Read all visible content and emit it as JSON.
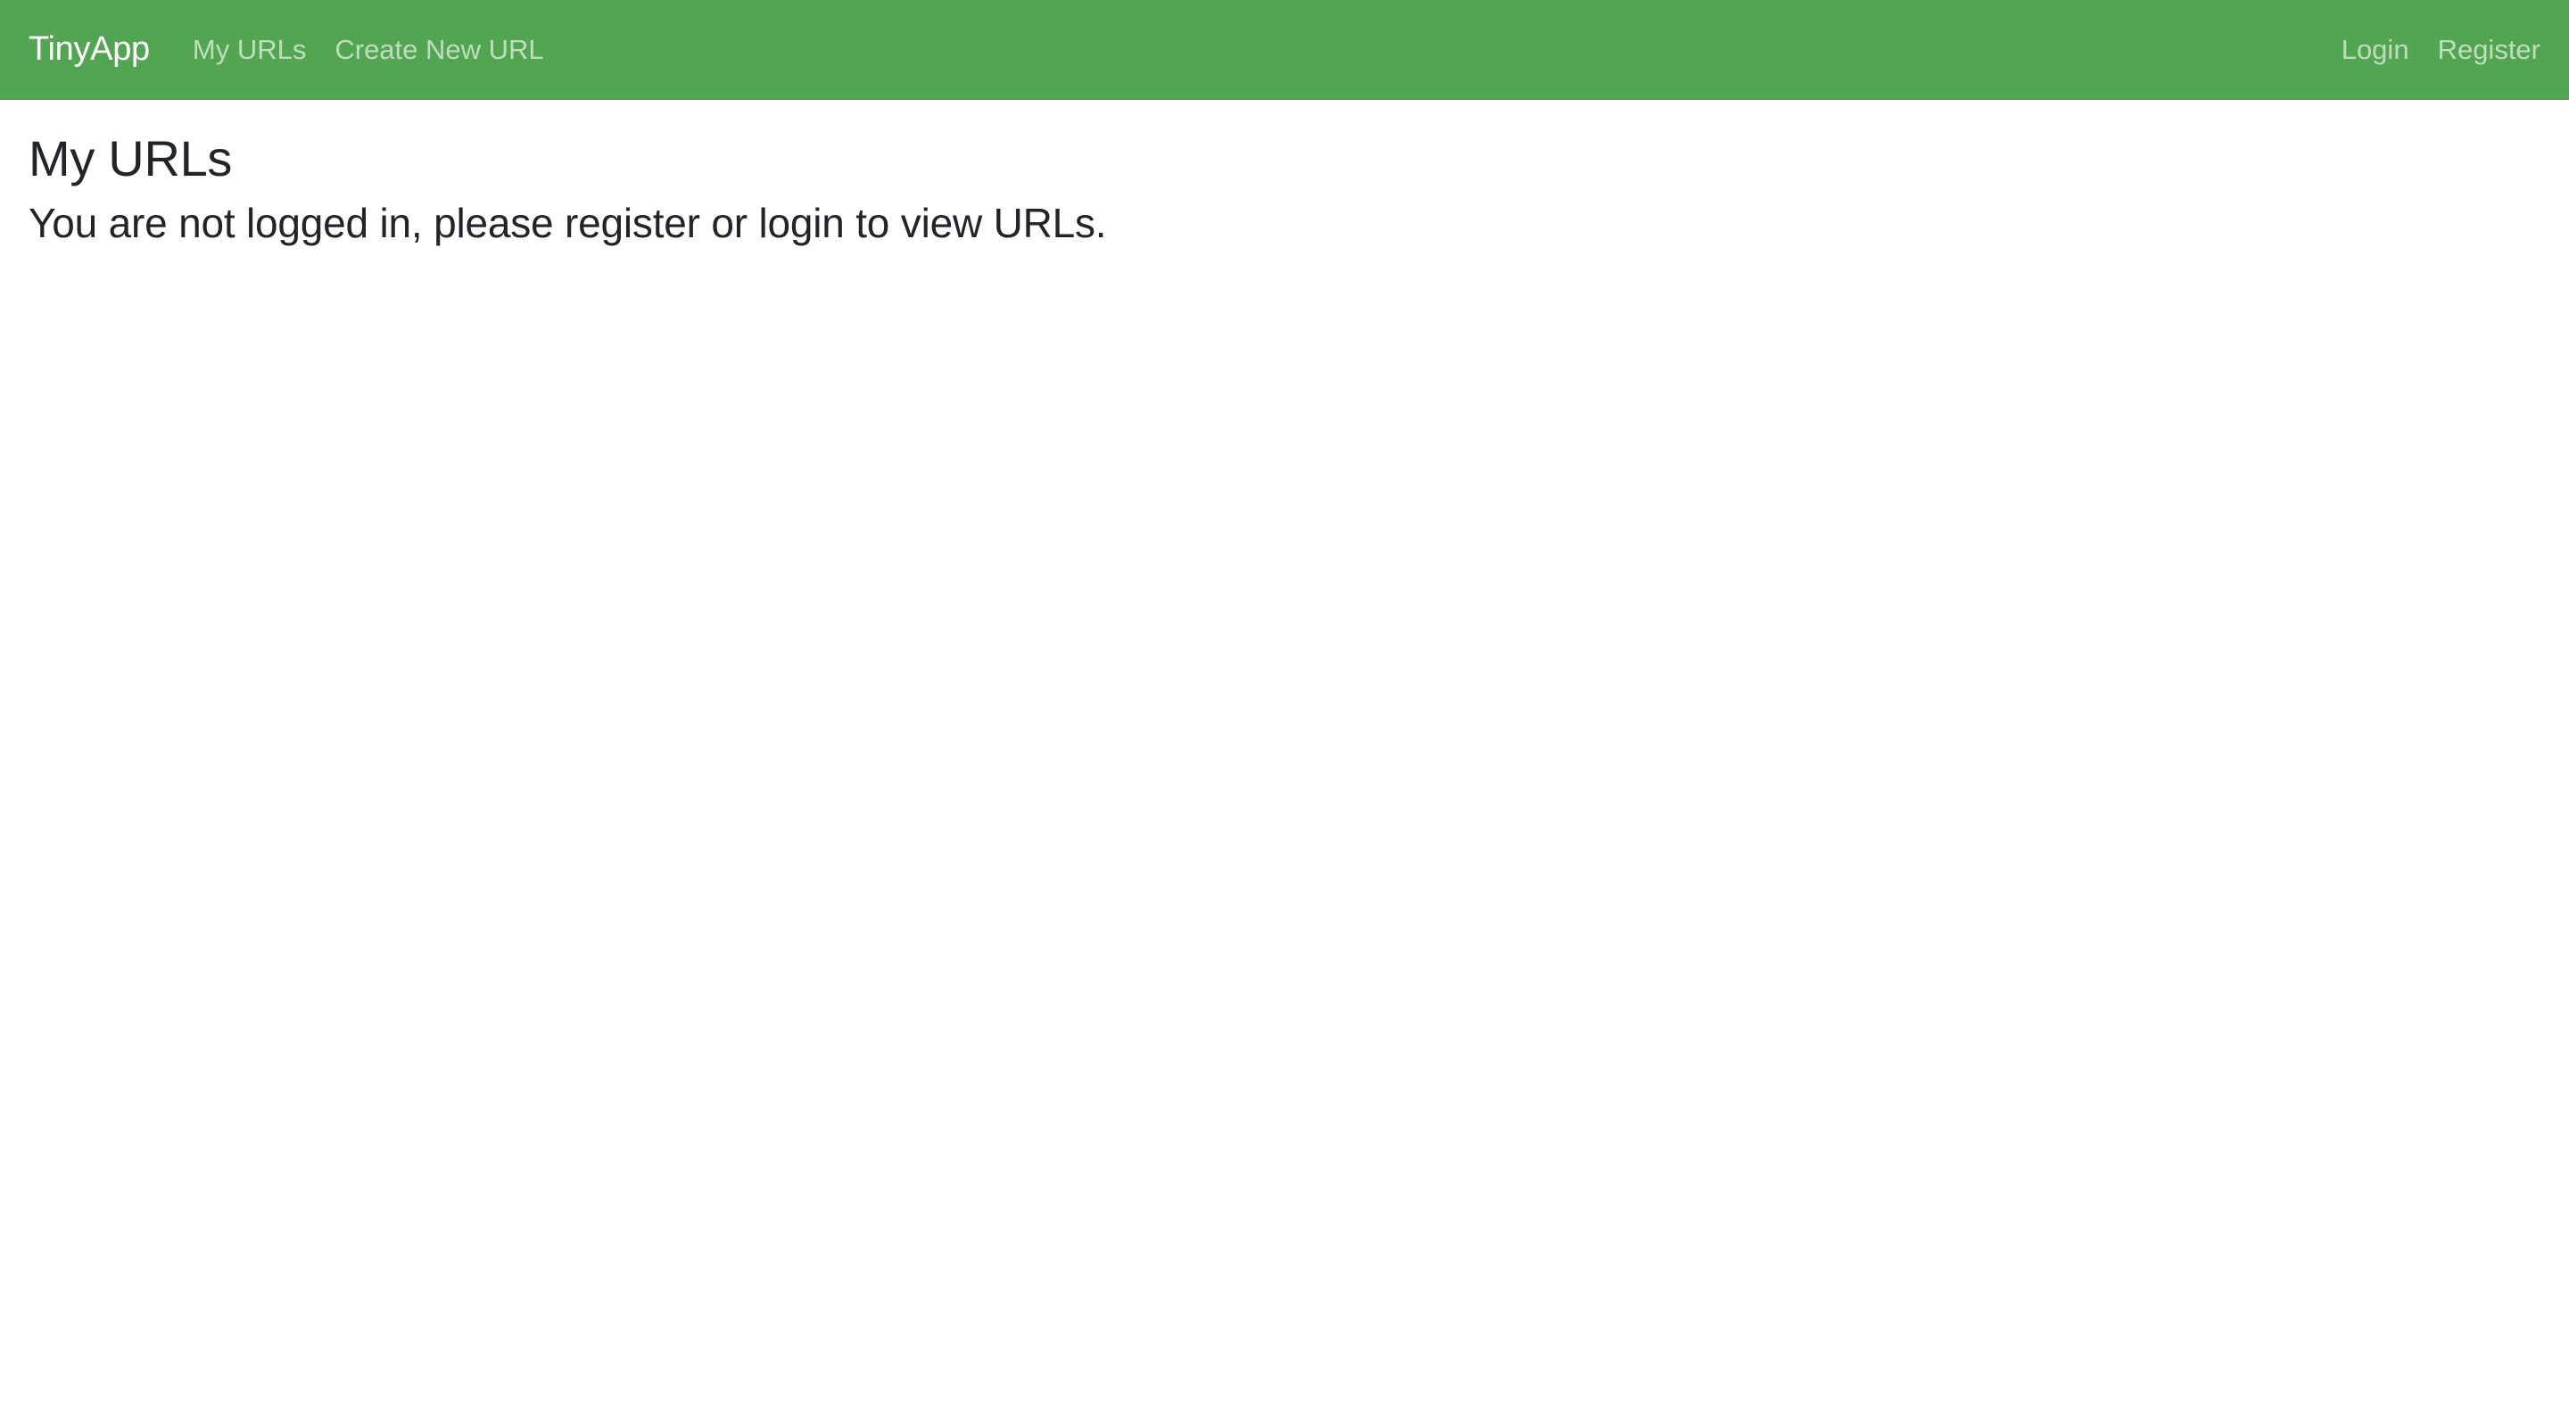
{
  "navbar": {
    "brand": "TinyApp",
    "left_links": {
      "my_urls": "My URLs",
      "create_new_url": "Create New URL"
    },
    "right_links": {
      "login": "Login",
      "register": "Register"
    },
    "background_color": "#52a652"
  },
  "main": {
    "title": "My URLs",
    "message": "You are not logged in, please register or login to view URLs."
  }
}
